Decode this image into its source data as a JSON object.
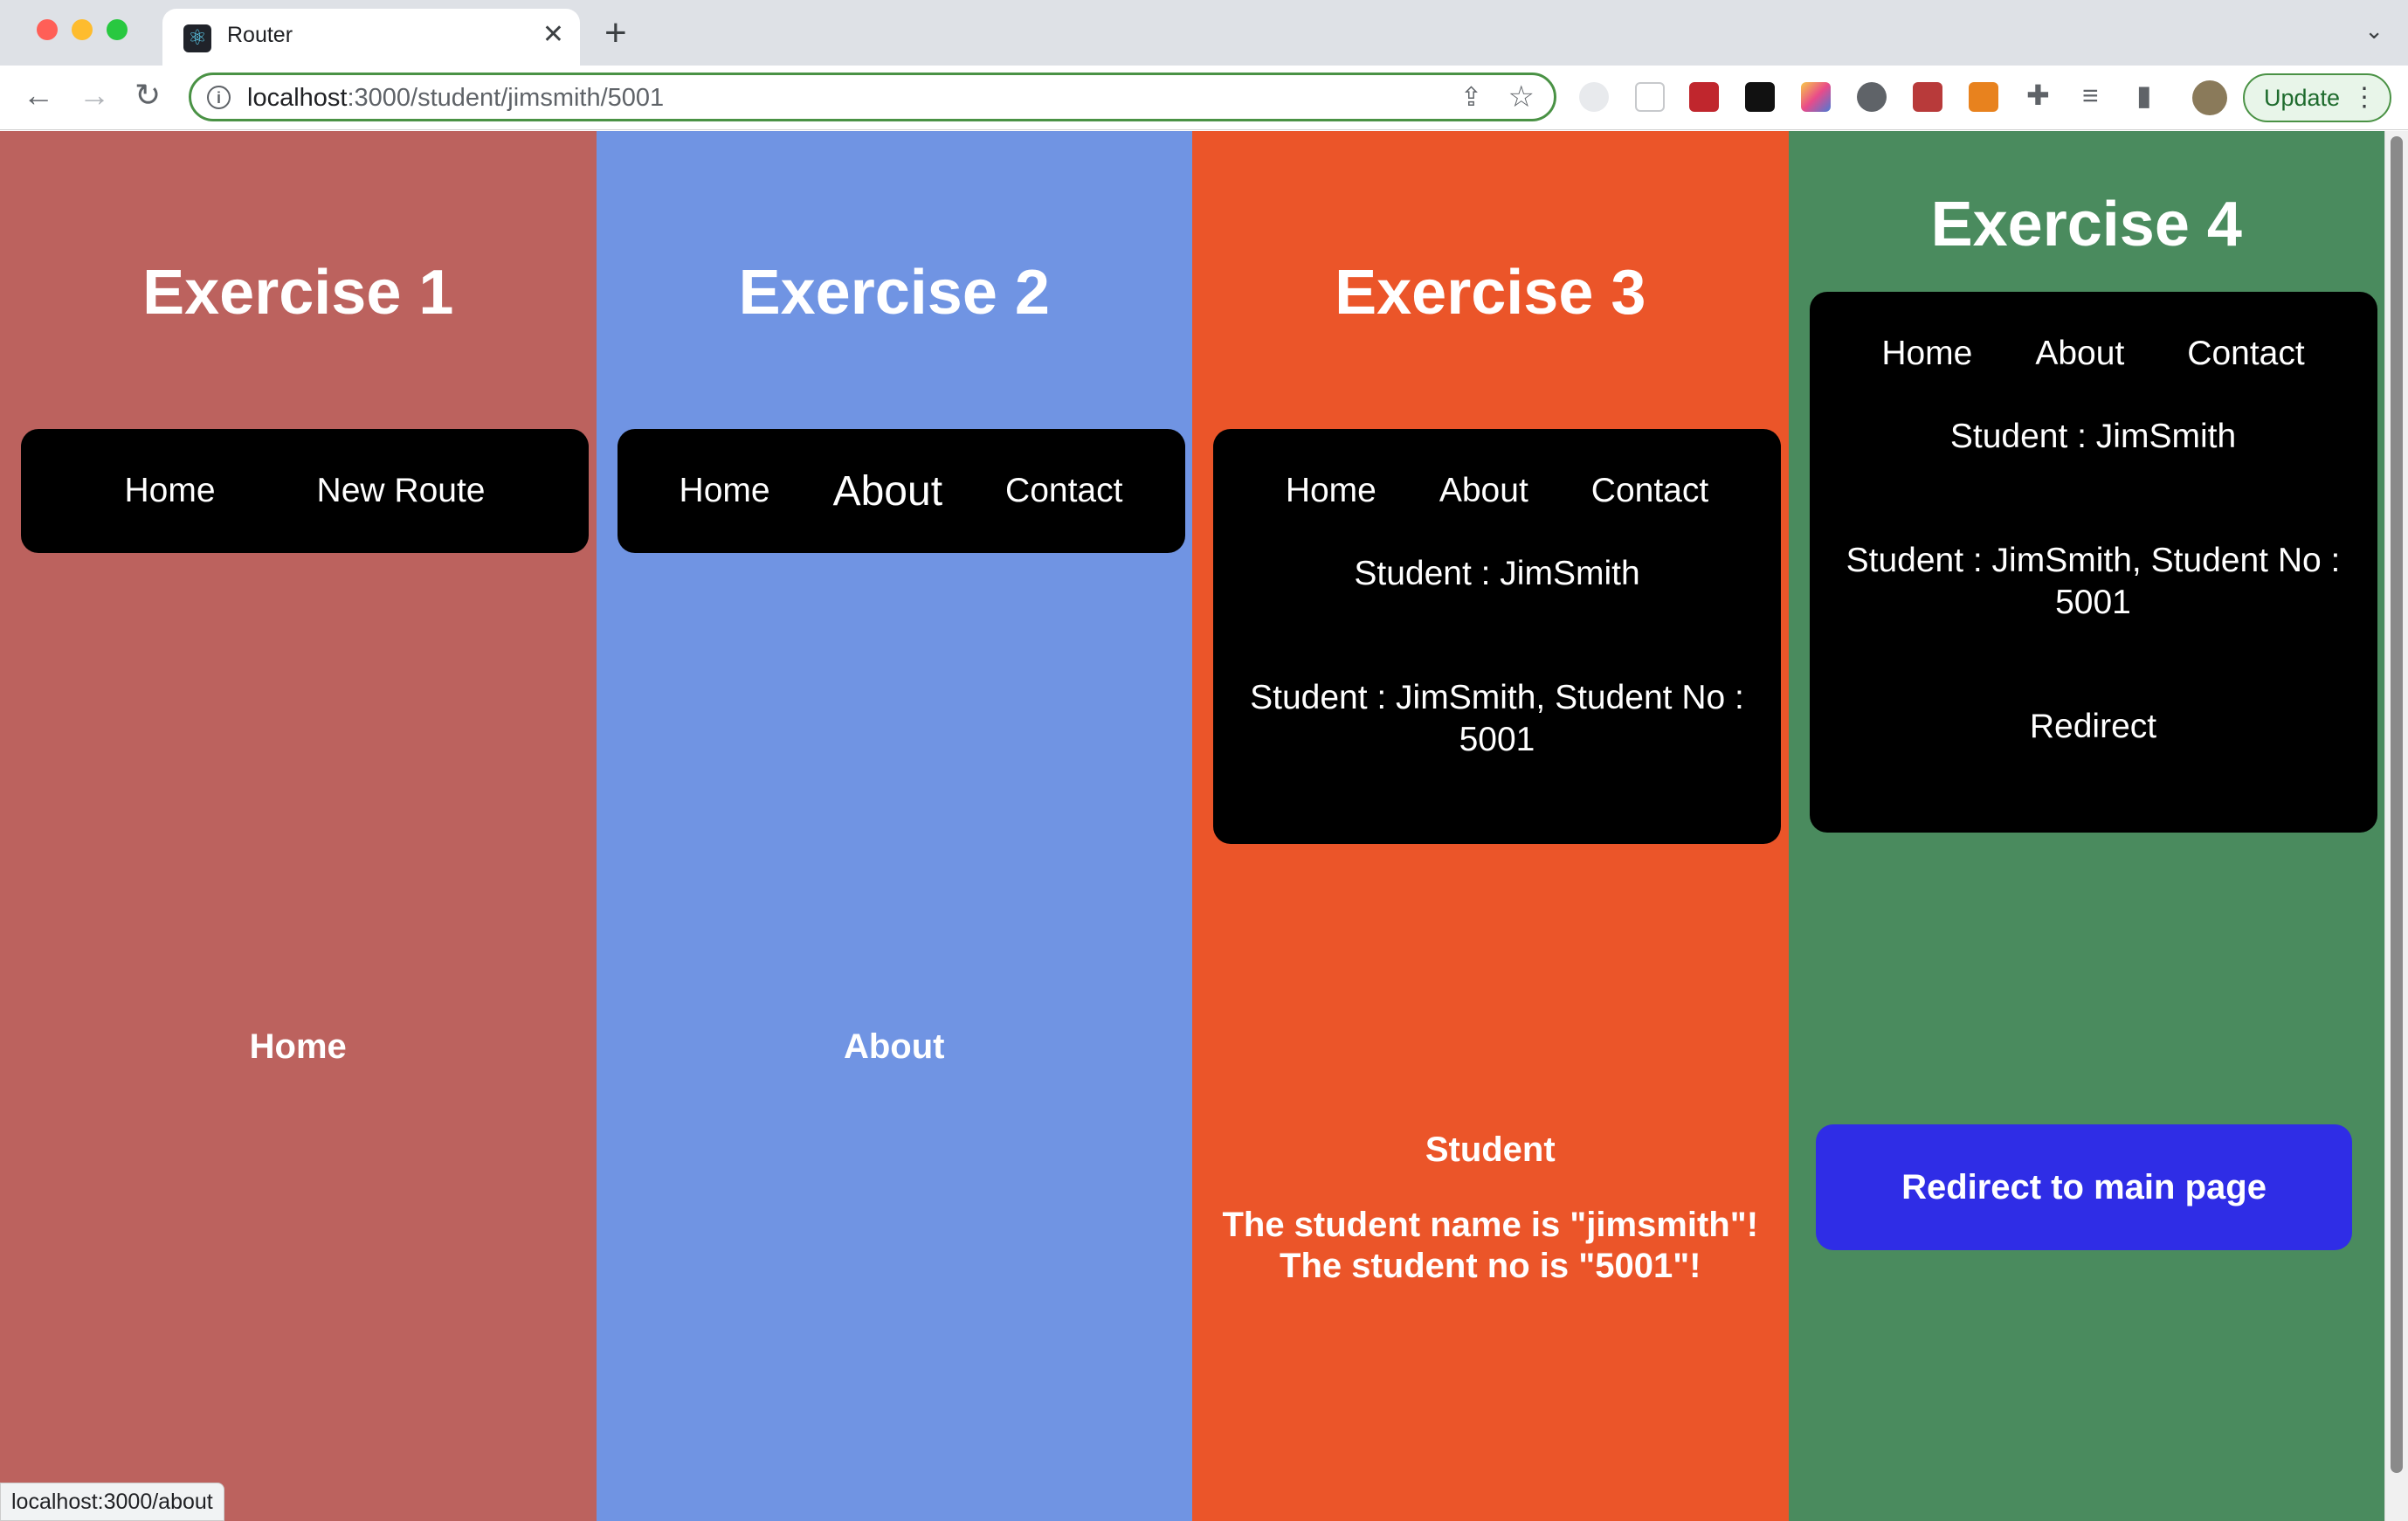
{
  "browser": {
    "tab_title": "Router",
    "tab_favicon": "react-icon",
    "url_host": "localhost",
    "url_path": ":3000/student/jimsmith/5001",
    "update_label": "Update",
    "status_url": "localhost:3000/about"
  },
  "colors": {
    "exercise1_bg": "#bc625e",
    "exercise2_bg": "#7094e3",
    "exercise3_bg": "#eb5529",
    "exercise4_bg": "#4a8b5e",
    "nav_bg": "#000000",
    "redirect_button_bg": "#2f2de6"
  },
  "exercise1": {
    "title": "Exercise 1",
    "nav": [
      "Home",
      "New Route"
    ],
    "content": "Home"
  },
  "exercise2": {
    "title": "Exercise 2",
    "nav": [
      "Home",
      "About",
      "Contact"
    ],
    "content": "About"
  },
  "exercise3": {
    "title": "Exercise 3",
    "nav": [
      "Home",
      "About",
      "Contact"
    ],
    "student_line": "Student : JimSmith",
    "student_no_line1": "Student : JimSmith, Student No :",
    "student_no_line2": "5001",
    "content_heading": "Student",
    "content_line1": "The student name is \"jimsmith\"!",
    "content_line2": "The student no is \"5001\"!"
  },
  "exercise4": {
    "title": "Exercise 4",
    "nav": [
      "Home",
      "About",
      "Contact"
    ],
    "student_line": "Student : JimSmith",
    "student_no_line1": "Student : JimSmith, Student No :",
    "student_no_line2": "5001",
    "redirect_link": "Redirect",
    "redirect_button": "Redirect to main page"
  }
}
